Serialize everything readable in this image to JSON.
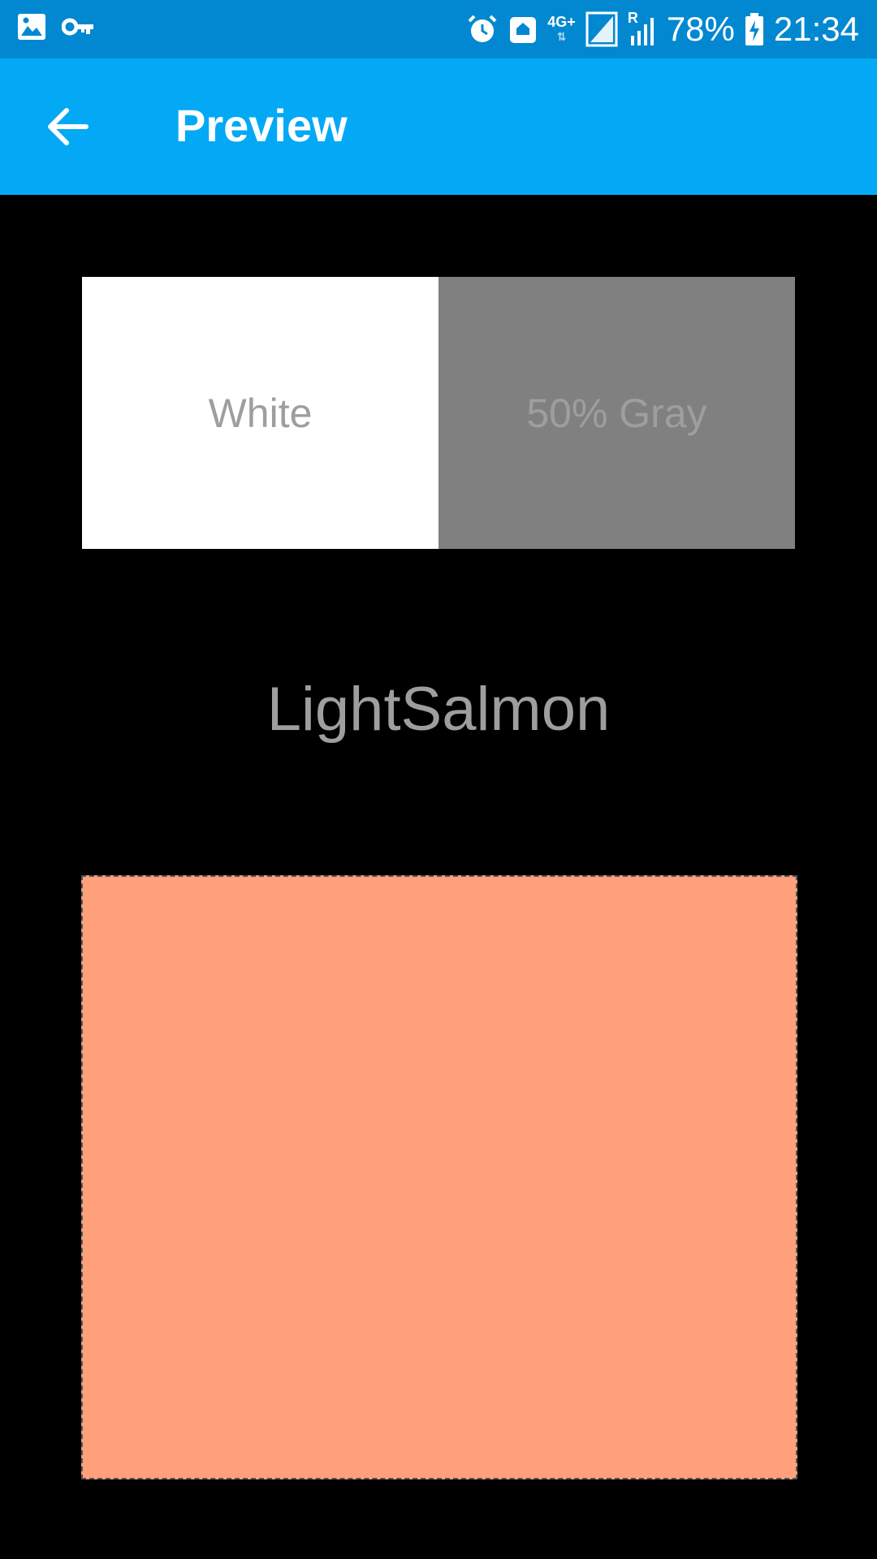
{
  "status_bar": {
    "icons_left": [
      "image-icon",
      "key-icon"
    ],
    "icons_right": [
      "alarm-icon",
      "home-signal-icon",
      "network-4g-icon",
      "signal-icon",
      "roaming-signal-icon",
      "battery-charging-icon"
    ],
    "network_label": "4G+",
    "roaming_label": "R",
    "battery_level": "78%",
    "time": "21:34"
  },
  "app_bar": {
    "back_icon": "arrow-left-icon",
    "title": "Preview"
  },
  "swatches": [
    {
      "label": "White",
      "color": "#FFFFFF"
    },
    {
      "label": "50% Gray",
      "color": "#808080"
    }
  ],
  "color": {
    "name": "LightSalmon",
    "hex": "#FFA07A"
  },
  "theme": {
    "status_bar_color": "#0288D1",
    "app_bar_color": "#03A9F4",
    "background": "#000000"
  }
}
